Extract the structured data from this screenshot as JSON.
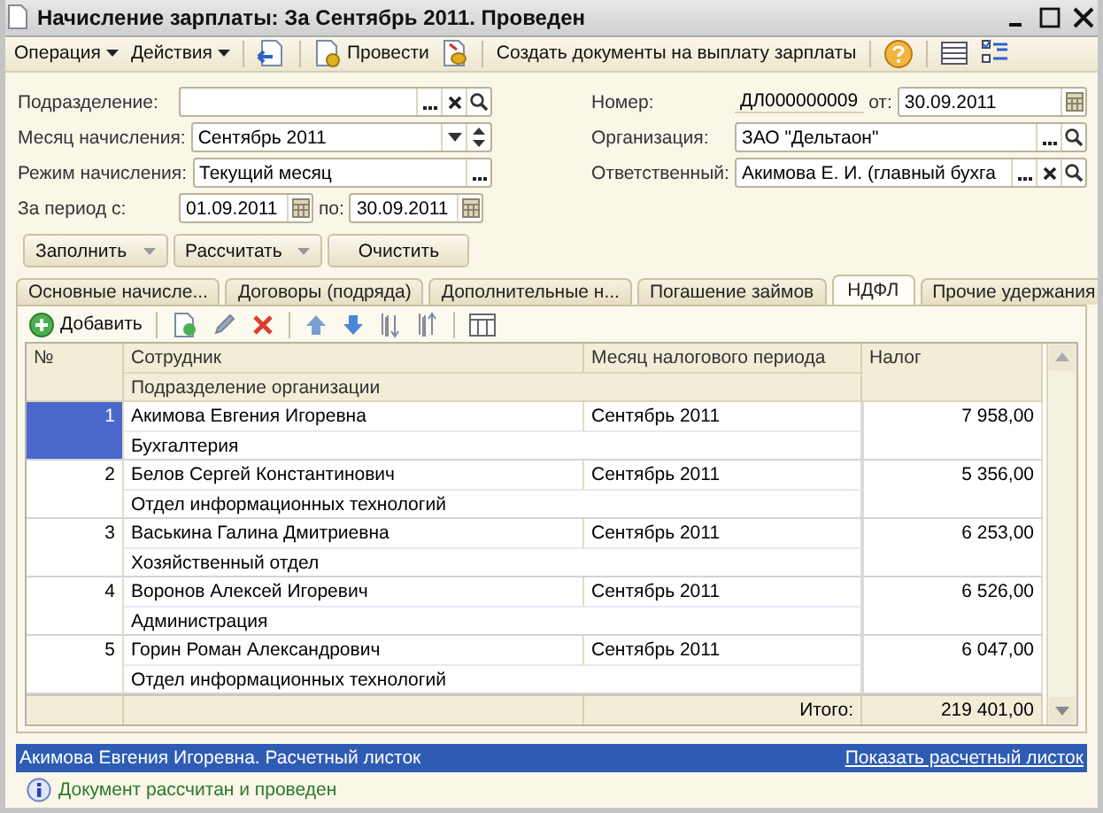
{
  "window": {
    "title": "Начисление зарплаты: За Сентябрь 2011. Проведен"
  },
  "toolbar": [
    {
      "kind": "menu",
      "label": "Операция"
    },
    {
      "kind": "menu",
      "label": "Действия"
    },
    {
      "kind": "separator"
    },
    {
      "kind": "icon"
    },
    {
      "kind": "separator"
    },
    {
      "kind": "button",
      "label": "Провести"
    },
    {
      "kind": "icon"
    },
    {
      "kind": "separator"
    },
    {
      "kind": "text",
      "label": "Создать документы на выплату зарплаты"
    },
    {
      "kind": "separator"
    },
    {
      "kind": "icon"
    },
    {
      "kind": "separator"
    },
    {
      "kind": "icon"
    },
    {
      "kind": "icon"
    }
  ],
  "form": {
    "left": [
      {
        "label": "Подразделение:",
        "kind": "reference"
      },
      {
        "label": "Месяц начисления:",
        "kind": "month",
        "value": "Сентябрь 2011"
      },
      {
        "label": "Режим начисления:",
        "kind": "choice",
        "value": "Текущий месяц"
      },
      {
        "label": "За период с:",
        "kind": "period",
        "from": "01.09.2011",
        "to_label": "по:",
        "to": "30.09.2011"
      }
    ],
    "right": [
      {
        "label": "Номер:",
        "kind": "number",
        "value": "ДЛ000000009",
        "date_label": "от:",
        "date": "30.09.2011"
      },
      {
        "label": "Организация:",
        "kind": "lookup",
        "value": "ЗАО \"Дельтаон\""
      },
      {
        "label": "Ответственный:",
        "kind": "reference",
        "value": "Акимова Е. И. (главный бухга"
      }
    ]
  },
  "actions": [
    {
      "label": "Заполнить",
      "dropdown": true
    },
    {
      "label": "Рассчитать",
      "dropdown": true
    },
    {
      "label": "Очистить",
      "dropdown": false
    }
  ],
  "tabs": [
    {
      "label": "Основные начисле...",
      "selected": false
    },
    {
      "label": "Договоры (подряда)",
      "selected": false
    },
    {
      "label": "Дополнительные н...",
      "selected": false
    },
    {
      "label": "Погашение займов",
      "selected": false
    },
    {
      "label": "НДФЛ",
      "selected": true
    },
    {
      "label": "Прочие удержания",
      "selected": false
    }
  ],
  "table_toolbar": [
    {
      "kind": "button",
      "label": "Добавить"
    },
    {
      "kind": "separator"
    },
    {
      "kind": "icon"
    },
    {
      "kind": "icon"
    },
    {
      "kind": "icon"
    },
    {
      "kind": "separator"
    },
    {
      "kind": "icon"
    },
    {
      "kind": "icon"
    },
    {
      "kind": "icon"
    },
    {
      "kind": "icon"
    },
    {
      "kind": "separator"
    },
    {
      "kind": "icon"
    }
  ],
  "table": {
    "columns": {
      "number": "№",
      "employee": "Сотрудник",
      "department": "Подразделение организации",
      "month": "Месяц налогового периода",
      "tax": "Налог"
    },
    "rows": [
      {
        "number": "1",
        "employee": "Акимова Евгения Игоревна",
        "department": "Бухгалтерия",
        "month": "Сентябрь 2011",
        "tax": "7 958,00",
        "selected": true
      },
      {
        "number": "2",
        "employee": "Белов Сергей Константинович",
        "department": "Отдел информационных технологий",
        "month": "Сентябрь 2011",
        "tax": "5 356,00",
        "selected": false
      },
      {
        "number": "3",
        "employee": "Васькина Галина Дмитриевна",
        "department": "Хозяйственный отдел",
        "month": "Сентябрь 2011",
        "tax": "6 253,00",
        "selected": false
      },
      {
        "number": "4",
        "employee": "Воронов Алексей Игоревич",
        "department": "Администрация",
        "month": "Сентябрь 2011",
        "tax": "6 526,00",
        "selected": false
      },
      {
        "number": "5",
        "employee": "Горин Роман Александрович",
        "department": "Отдел информационных технологий",
        "month": "Сентябрь 2011",
        "tax": "6 047,00",
        "selected": false
      }
    ],
    "total_label": "Итого:",
    "total": "219 401,00"
  },
  "info_bar": {
    "text": "Акимова Евгения Игоревна. Расчетный листок",
    "link": "Показать расчетный листок"
  },
  "status": {
    "message": "Документ рассчитан и проведен"
  }
}
